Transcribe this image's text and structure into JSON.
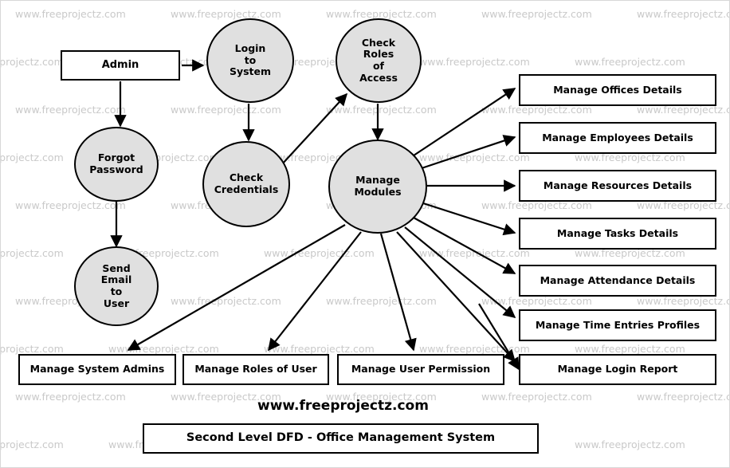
{
  "diagram": {
    "title": "Second Level DFD - Office Management System",
    "site_label": "www.freeprojectz.com",
    "watermark_text": "www.freeprojectz.com",
    "colors": {
      "process_fill": "#e0e0e0",
      "stroke": "#000000",
      "box_fill": "#ffffff",
      "watermark": "#c9c9c9",
      "page_background": "#ffffff"
    },
    "external_entities": [
      {
        "id": "admin",
        "label": "Admin"
      }
    ],
    "processes": [
      {
        "id": "login_to_system",
        "label": "Login to System",
        "lines": [
          "Login",
          "to",
          "System"
        ]
      },
      {
        "id": "check_roles_of_access",
        "label": "Check Roles of Access",
        "lines": [
          "Check",
          "Roles",
          "of",
          "Access"
        ]
      },
      {
        "id": "forgot_password",
        "label": "Forgot Password",
        "lines": [
          "Forgot",
          "Password"
        ]
      },
      {
        "id": "check_credentials",
        "label": "Check Credentials",
        "lines": [
          "Check",
          "Credentials"
        ]
      },
      {
        "id": "send_email_to_user",
        "label": "Send Email to User",
        "lines": [
          "Send",
          "Email",
          "to",
          "User"
        ]
      },
      {
        "id": "manage_modules",
        "label": "Manage Modules",
        "lines": [
          "Manage",
          "Modules"
        ]
      }
    ],
    "data_stores_right": [
      {
        "id": "offices",
        "label": "Manage Offices Details"
      },
      {
        "id": "employees",
        "label": "Manage Employees Details"
      },
      {
        "id": "resources",
        "label": "Manage Resources Details"
      },
      {
        "id": "tasks",
        "label": "Manage Tasks Details"
      },
      {
        "id": "attendance",
        "label": "Manage Attendance Details"
      },
      {
        "id": "time_entries",
        "label": "Manage Time Entries Profiles"
      },
      {
        "id": "login_report",
        "label": "Manage Login  Report"
      }
    ],
    "data_stores_bottom": [
      {
        "id": "system_admins",
        "label": "Manage System Admins"
      },
      {
        "id": "roles_of_user",
        "label": "Manage Roles of User"
      },
      {
        "id": "user_permission",
        "label": "Manage User Permission"
      },
      {
        "id": "login_report_bottom",
        "label": "Manage Login  Report"
      }
    ],
    "flows": [
      {
        "from": "admin",
        "to": "login_to_system"
      },
      {
        "from": "admin",
        "to": "forgot_password"
      },
      {
        "from": "login_to_system",
        "to": "check_credentials"
      },
      {
        "from": "forgot_password",
        "to": "send_email_to_user"
      },
      {
        "from": "check_credentials",
        "to": "check_roles_of_access"
      },
      {
        "from": "check_roles_of_access",
        "to": "manage_modules"
      },
      {
        "from": "manage_modules",
        "to": "offices"
      },
      {
        "from": "manage_modules",
        "to": "employees"
      },
      {
        "from": "manage_modules",
        "to": "resources"
      },
      {
        "from": "manage_modules",
        "to": "tasks"
      },
      {
        "from": "manage_modules",
        "to": "attendance"
      },
      {
        "from": "manage_modules",
        "to": "time_entries"
      },
      {
        "from": "manage_modules",
        "to": "login_report"
      },
      {
        "from": "manage_modules",
        "to": "system_admins"
      },
      {
        "from": "manage_modules",
        "to": "roles_of_user"
      },
      {
        "from": "manage_modules",
        "to": "user_permission"
      },
      {
        "from": "manage_modules",
        "to": "login_report_bottom"
      }
    ]
  }
}
